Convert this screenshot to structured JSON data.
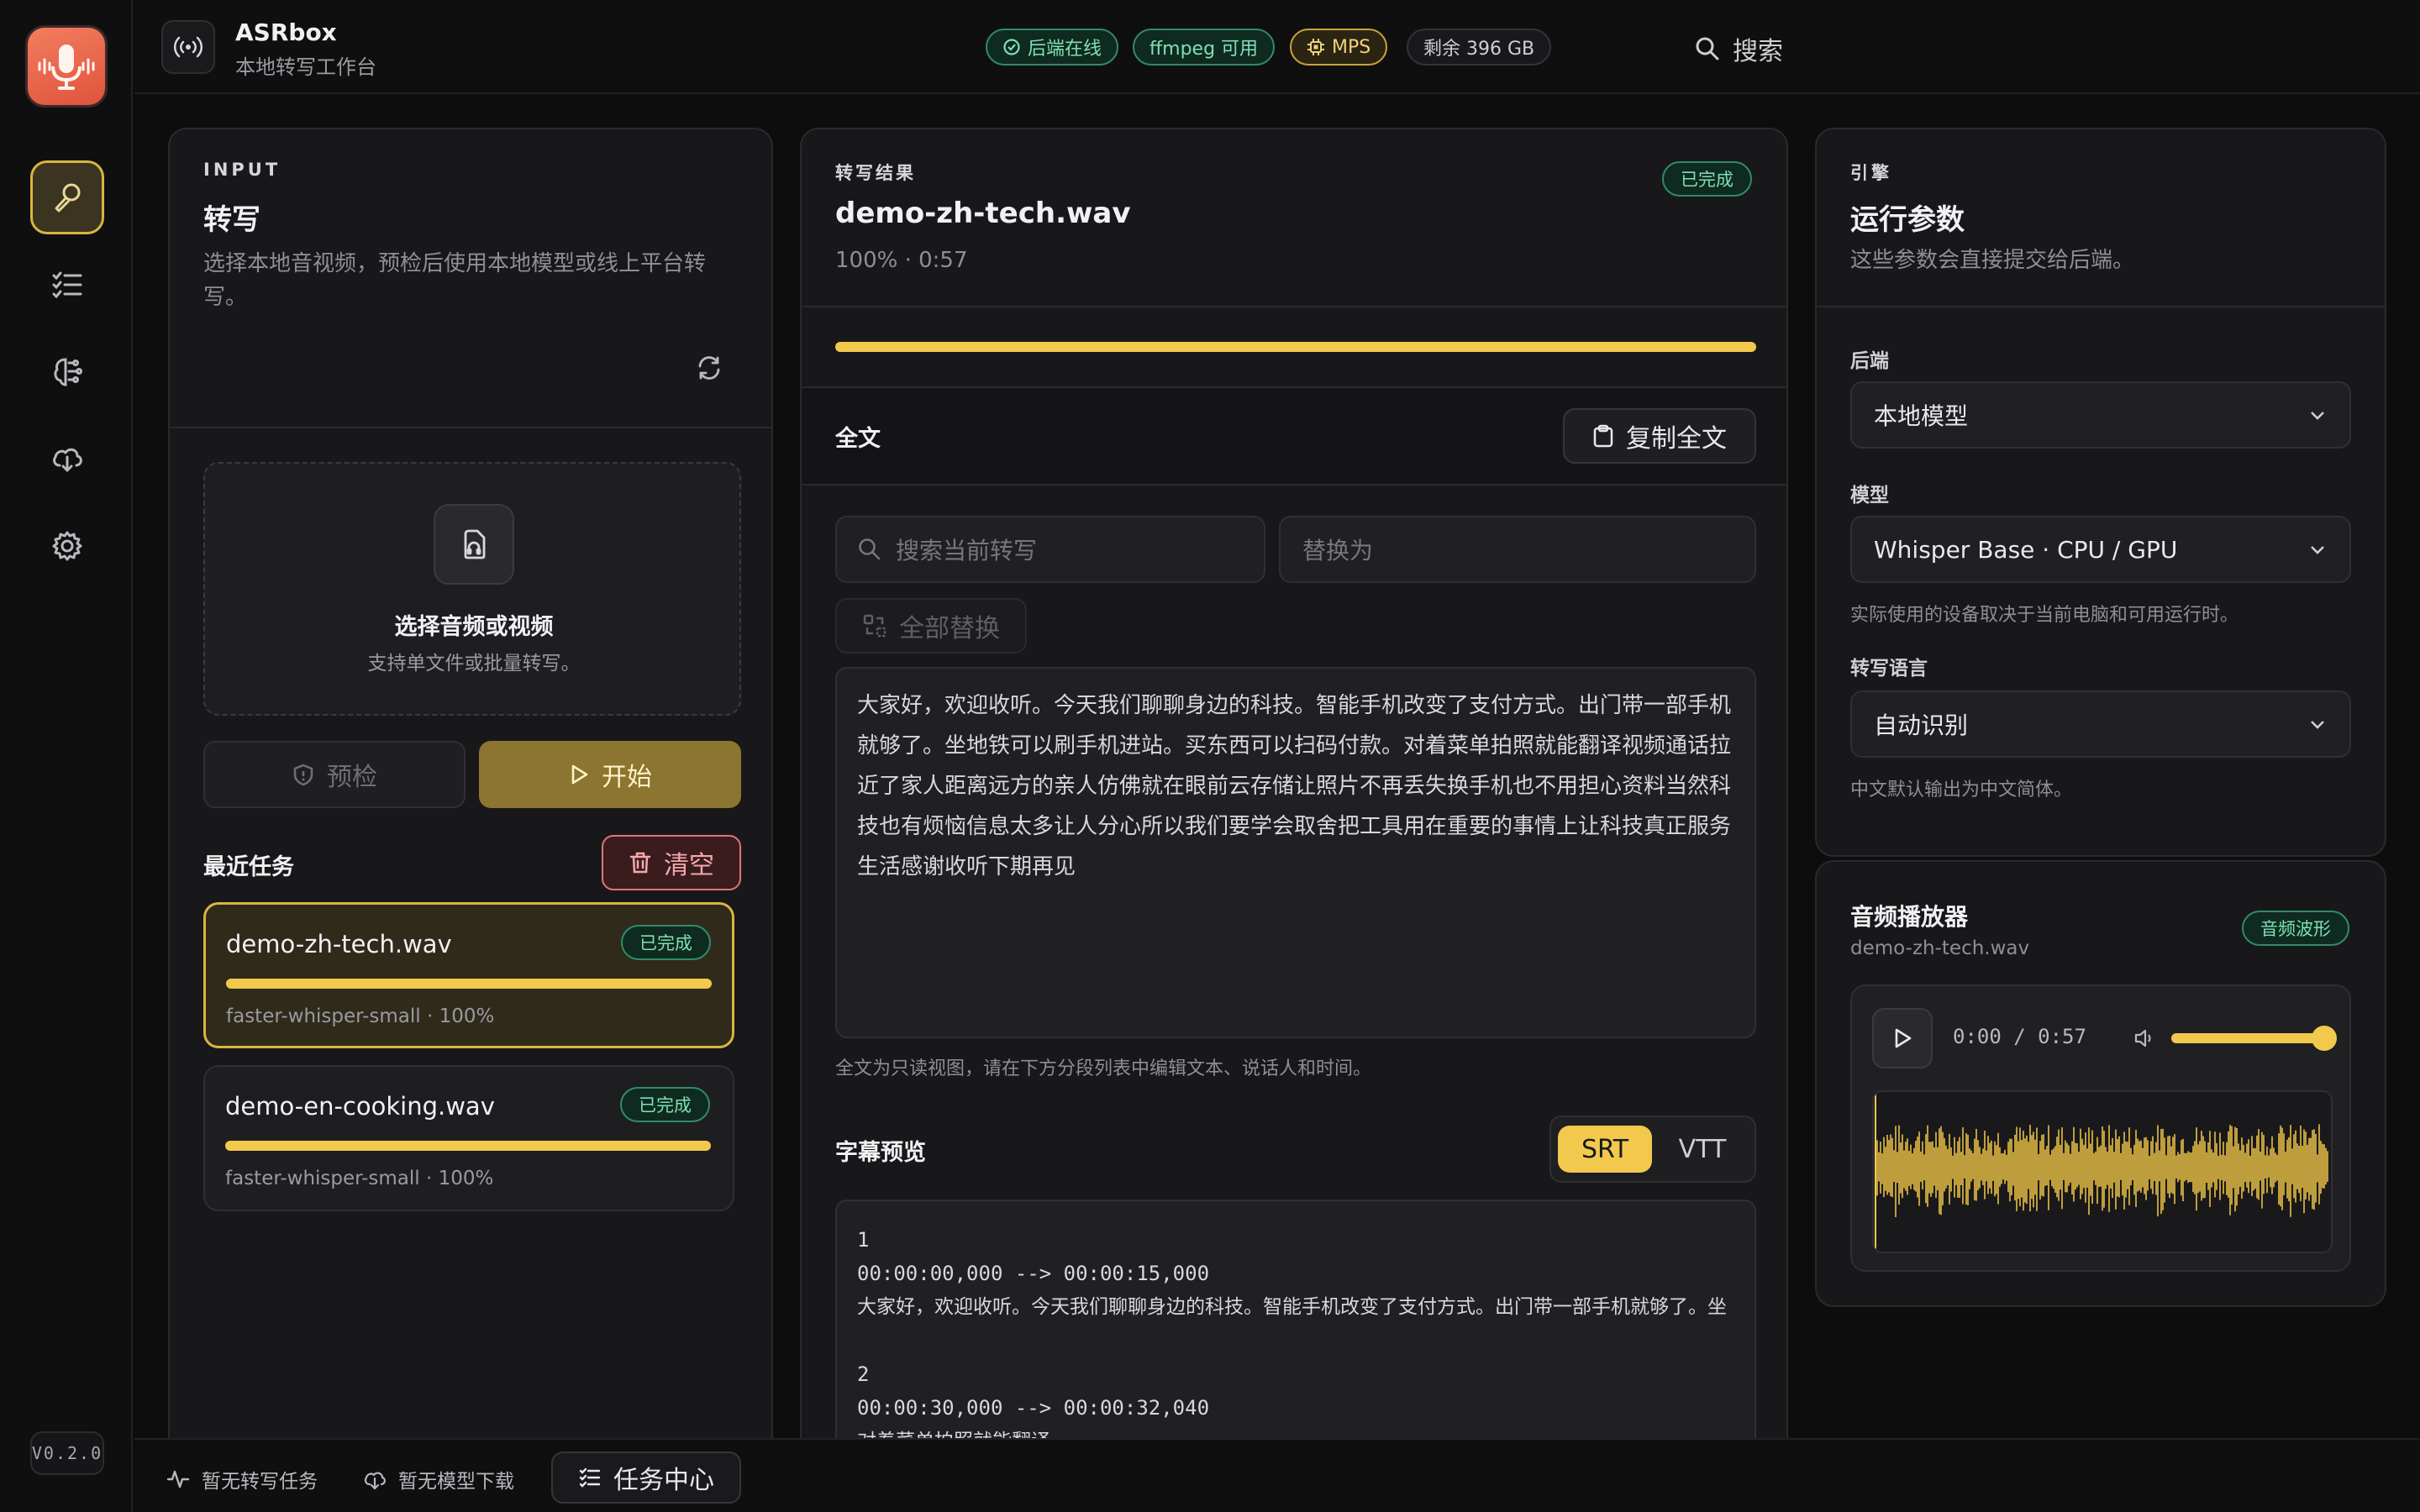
{
  "app": {
    "name": "ASRbox",
    "subtitle": "本地转写工作台",
    "version": "V0.2.0"
  },
  "header": {
    "search_label": "搜索",
    "badges": {
      "backend": "后端在线",
      "ffmpeg": "ffmpeg 可用",
      "device": "MPS",
      "disk": "剩余 396 GB"
    }
  },
  "nav": {
    "items": [
      "transcribe",
      "tasks",
      "models",
      "downloads",
      "settings"
    ]
  },
  "input_panel": {
    "eyebrow": "INPUT",
    "title": "转写",
    "description": "选择本地音视频，预检后使用本地模型或线上平台转写。",
    "dropzone": {
      "title": "选择音频或视频",
      "hint": "支持单文件或批量转写。"
    },
    "precheck_label": "预检",
    "start_label": "开始",
    "recent_title": "最近任务",
    "clear_label": "清空",
    "tasks": [
      {
        "name": "demo-zh-tech.wav",
        "status": "已完成",
        "meta": "faster-whisper-small · 100%",
        "progress": 1.0,
        "selected": true
      },
      {
        "name": "demo-en-cooking.wav",
        "status": "已完成",
        "meta": "faster-whisper-small · 100%",
        "progress": 1.0,
        "selected": false
      }
    ]
  },
  "result_panel": {
    "eyebrow": "转写结果",
    "file": "demo-zh-tech.wav",
    "meta": "100% · 0:57",
    "status": "已完成",
    "progress": 1.0,
    "fulltext_label": "全文",
    "copy_label": "复制全文",
    "search_placeholder": "搜索当前转写",
    "replace_placeholder": "替换为",
    "replace_all_label": "全部替换",
    "fulltext": "大家好，欢迎收听。今天我们聊聊身边的科技。智能手机改变了支付方式。出门带一部手机就够了。坐地铁可以刷手机进站。买东西可以扫码付款。对着菜单拍照就能翻译视频通话拉近了家人距离远方的亲人仿佛就在眼前云存储让照片不再丢失换手机也不用担心资料当然科技也有烦恼信息太多让人分心所以我们要学会取舍把工具用在重要的事情上让科技真正服务生活感谢收听下期再见",
    "readonly_note": "全文为只读视图，请在下方分段列表中编辑文本、说话人和时间。",
    "subtitle_title": "字幕预览",
    "formats": [
      "SRT",
      "VTT"
    ],
    "active_format": "SRT",
    "srt": [
      {
        "index": "1",
        "time": "00:00:00,000 --> 00:00:15,000",
        "text": "大家好，欢迎收听。今天我们聊聊身边的科技。智能手机改变了支付方式。出门带一部手机就够了。坐"
      },
      {
        "index": "2",
        "time": "00:00:30,000 --> 00:00:32,040",
        "text": "对着菜单拍照就能翻译"
      }
    ]
  },
  "engine_panel": {
    "eyebrow": "引擎",
    "title": "运行参数",
    "description": "这些参数会直接提交给后端。",
    "backend_label": "后端",
    "backend_value": "本地模型",
    "model_label": "模型",
    "model_value": "Whisper Base · CPU / GPU",
    "model_hint": "实际使用的设备取决于当前电脑和可用运行时。",
    "lang_label": "转写语言",
    "lang_value": "自动识别",
    "lang_hint": "中文默认输出为中文简体。"
  },
  "player": {
    "title": "音频播放器",
    "file": "demo-zh-tech.wav",
    "chip": "音频波形",
    "time": "0:00 / 0:57",
    "volume": 1.0
  },
  "footer": {
    "transcribe_status": "暂无转写任务",
    "download_status": "暂无模型下载",
    "task_center": "任务中心"
  },
  "colors": {
    "accent": "#f2c94c",
    "success": "#7fe0b4",
    "danger": "#f07a7a",
    "bg": "#0d0d0e"
  }
}
